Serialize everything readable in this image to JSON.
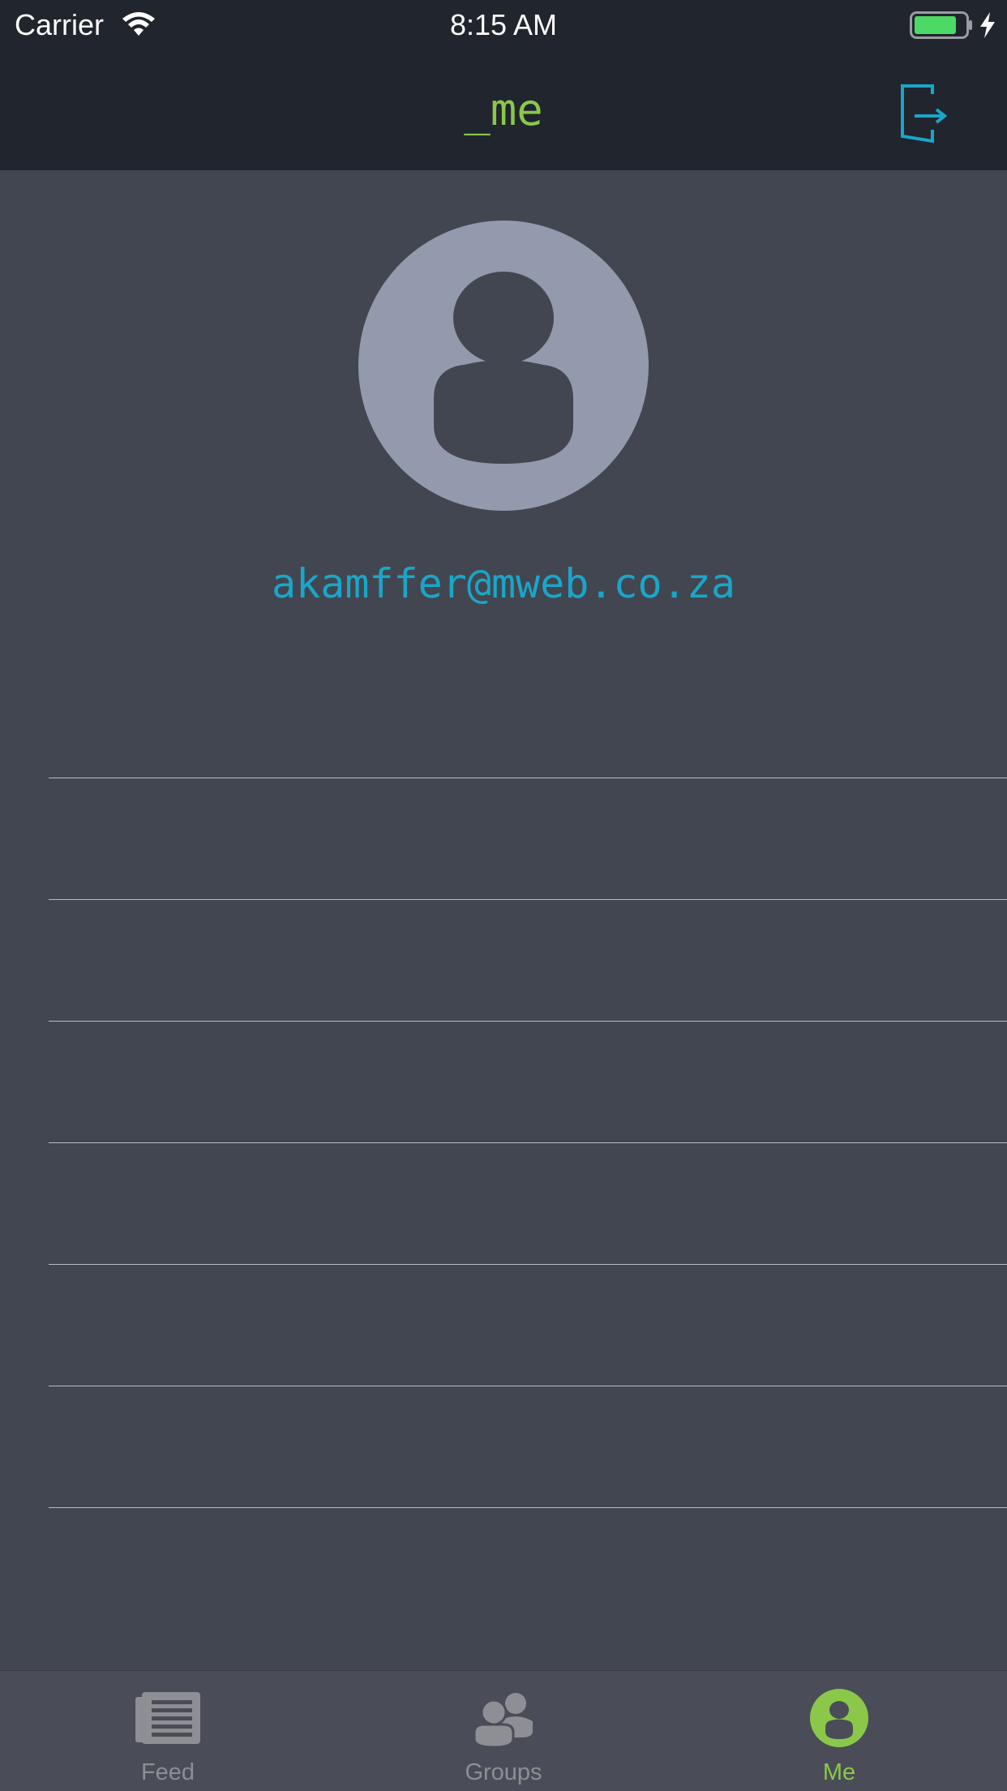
{
  "status_bar": {
    "carrier": "Carrier",
    "time": "8:15 AM",
    "battery_icon": "battery-charging-icon",
    "battery_level": 0.85,
    "battery_color": "#4cd964"
  },
  "nav": {
    "title": "_me",
    "title_color": "#8bc84a",
    "logout_icon": "logout-icon",
    "accent_color": "#1aa6c8"
  },
  "profile": {
    "avatar_icon": "person-avatar-icon",
    "email": "akamffer@mweb.co.za"
  },
  "list_rows": [
    "",
    "",
    "",
    "",
    "",
    "",
    "",
    ""
  ],
  "tab_bar": {
    "tabs": [
      {
        "label": "Feed",
        "icon": "newspaper-icon",
        "active": false
      },
      {
        "label": "Groups",
        "icon": "group-icon",
        "active": false
      },
      {
        "label": "Me",
        "icon": "person-circle-icon",
        "active": true
      }
    ]
  }
}
